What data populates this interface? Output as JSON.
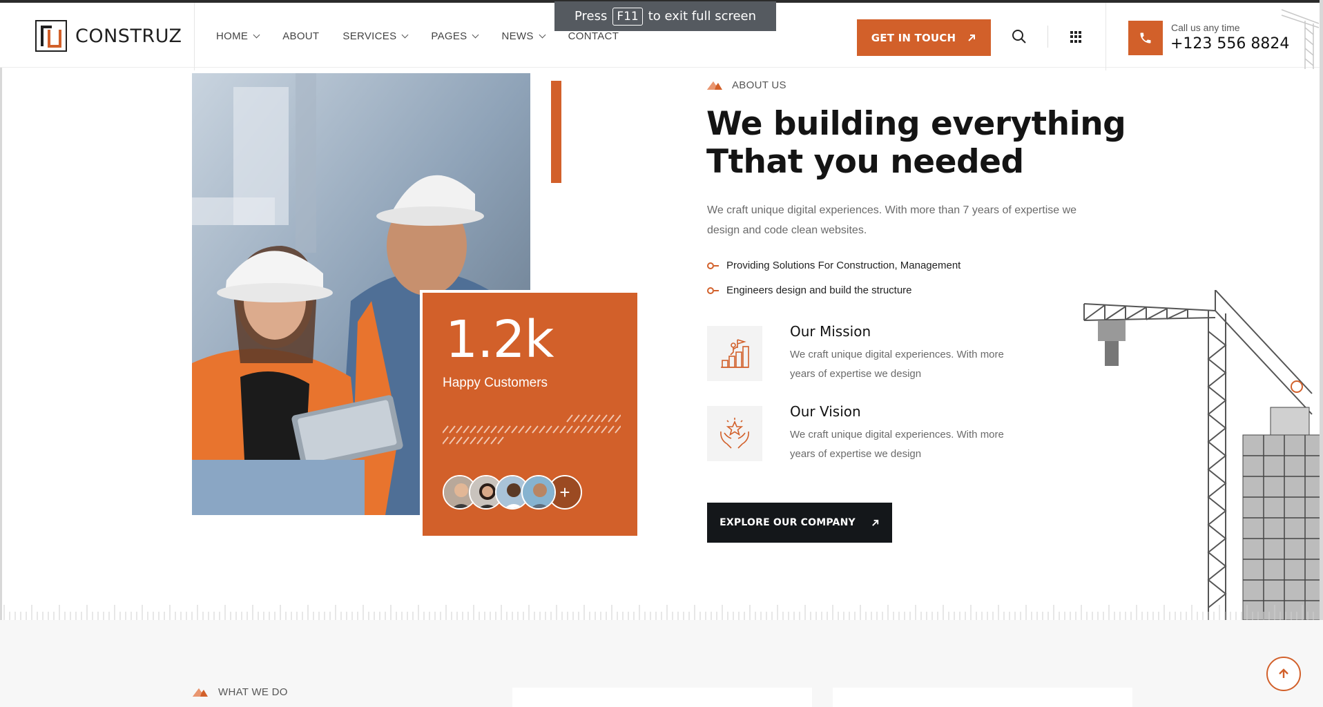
{
  "browser": {
    "fullscreen_press": "Press",
    "fullscreen_key": "F11",
    "fullscreen_suffix": "to exit full screen"
  },
  "header": {
    "brand": "CONSTRUZ",
    "nav": [
      {
        "label": "HOME",
        "dropdown": true
      },
      {
        "label": "ABOUT",
        "dropdown": false
      },
      {
        "label": "SERVICES",
        "dropdown": true
      },
      {
        "label": "PAGES",
        "dropdown": true
      },
      {
        "label": "NEWS",
        "dropdown": true
      },
      {
        "label": "CONTACT",
        "dropdown": false
      }
    ],
    "cta_label": "GET IN TOUCH",
    "call_label": "Call us any time",
    "call_number": "+123 556 8824"
  },
  "stats": {
    "value": "1.2k",
    "label": "Happy Customers",
    "plus_symbol": "+"
  },
  "about": {
    "eyebrow": "ABOUT US",
    "title_line1": "We building everything",
    "title_line2": "Tthat you needed",
    "lead": "We craft unique digital experiences. With more than 7 years of expertise we design and code clean websites.",
    "bullets": [
      "Providing Solutions For Construction, Management",
      "Engineers design and build the structure"
    ],
    "features": [
      {
        "title": "Our Mission",
        "text": "We craft unique digital experiences. With more years of expertise we design",
        "icon": "mission-flag-icon"
      },
      {
        "title": "Our Vision",
        "text": "We craft unique digital experiences. With more years of expertise we design",
        "icon": "vision-hands-star-icon"
      }
    ],
    "button_label": "EXPLORE OUR COMPANY"
  },
  "next_section": {
    "eyebrow": "WHAT WE DO"
  },
  "colors": {
    "accent": "#d2602a",
    "dark": "#14171a",
    "muted": "#6a6a6a"
  }
}
